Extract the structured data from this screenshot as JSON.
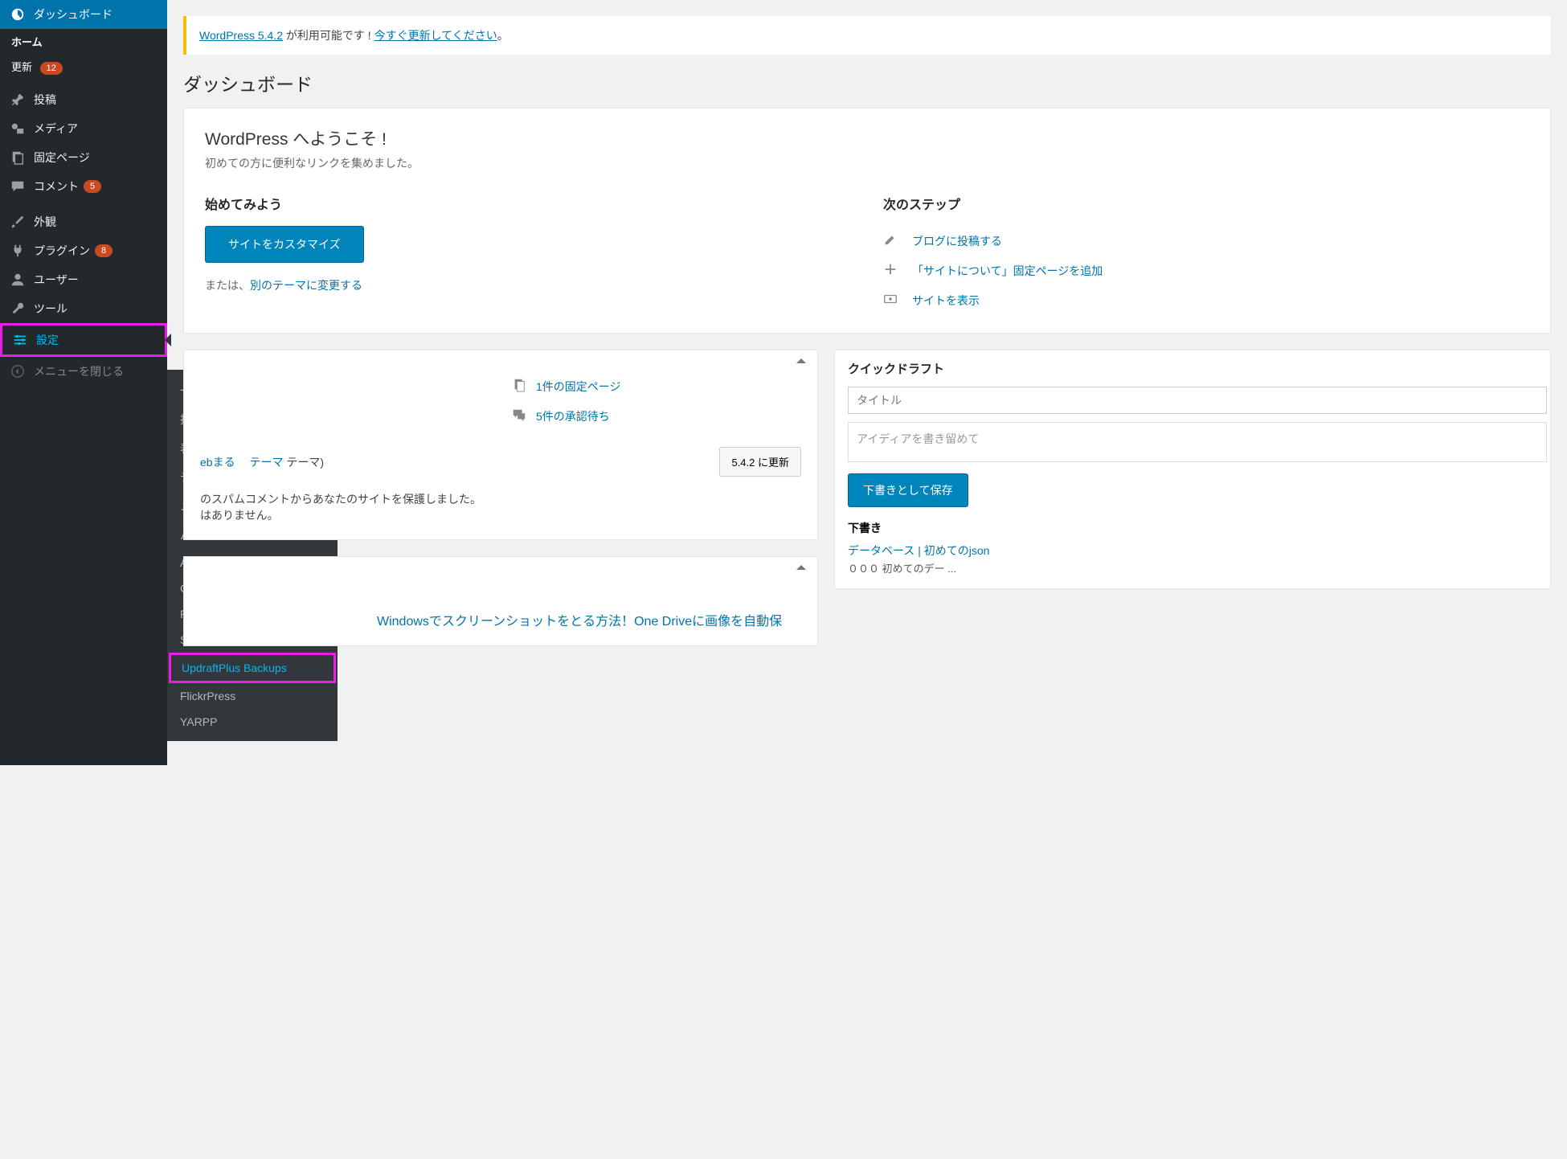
{
  "sidebar": {
    "dashboard": "ダッシュボード",
    "home": "ホーム",
    "updates": "更新",
    "updates_count": "12",
    "posts": "投稿",
    "media": "メディア",
    "pages": "固定ページ",
    "comments": "コメント",
    "comments_count": "5",
    "appearance": "外観",
    "plugins": "プラグイン",
    "plugins_count": "8",
    "users": "ユーザー",
    "tools": "ツール",
    "settings": "設定",
    "collapse": "メニューを閉じる"
  },
  "flyout": {
    "general": "一般",
    "writing": "投稿設定",
    "reading": "表示設定",
    "discussion": "ディスカッション",
    "media": "メディア",
    "permalink": "パーマリンク設定",
    "akismet": "Akismet",
    "crayon": "Crayon",
    "pubsub": "PubSubHubbub",
    "sakura": "SAKURA RS SSL",
    "updraft": "UpdraftPlus Backups",
    "flickr": "FlickrPress",
    "yarpp": "YARPP"
  },
  "notice": {
    "link1": "WordPress 5.4.2",
    "text1": " が利用可能です ! ",
    "link2": "今すぐ更新してください",
    "text2": "。"
  },
  "title": "ダッシュボード",
  "welcome": {
    "heading": "WordPress へようこそ !",
    "sub": "初めての方に便利なリンクを集めました。",
    "start_h": "始めてみよう",
    "customize": "サイトをカスタマイズ",
    "or_prefix": "または、",
    "or_link": "別のテーマに変更する",
    "next_h": "次のステップ",
    "step1": "ブログに投稿する",
    "step2": "「サイトについて」固定ページを追加",
    "step3": "サイトを表示"
  },
  "overview": {
    "pages_link": "1件の固定ページ",
    "pending_link": "5件の承認待ち",
    "theme_frag": "ebまる　",
    "theme_link": "テーマ",
    "theme_tail": " テーマ)",
    "update_btn": "5.4.2 に更新",
    "spam1": "のスパムコメントからあなたのサイトを保護しました。",
    "spam2": "はありません。"
  },
  "activity": {
    "link": "Windowsでスクリーンショットをとる方法！One Driveに画像を自動保"
  },
  "quick": {
    "heading": "クイックドラフト",
    "title_ph": "タイトル",
    "content_ph": "アイディアを書き留めて",
    "save": "下書きとして保存",
    "drafts_h": "下書き",
    "d1a": "データベース",
    "d1b": "初めてのjson",
    "d2": "０００ 初めてのデー ..."
  }
}
